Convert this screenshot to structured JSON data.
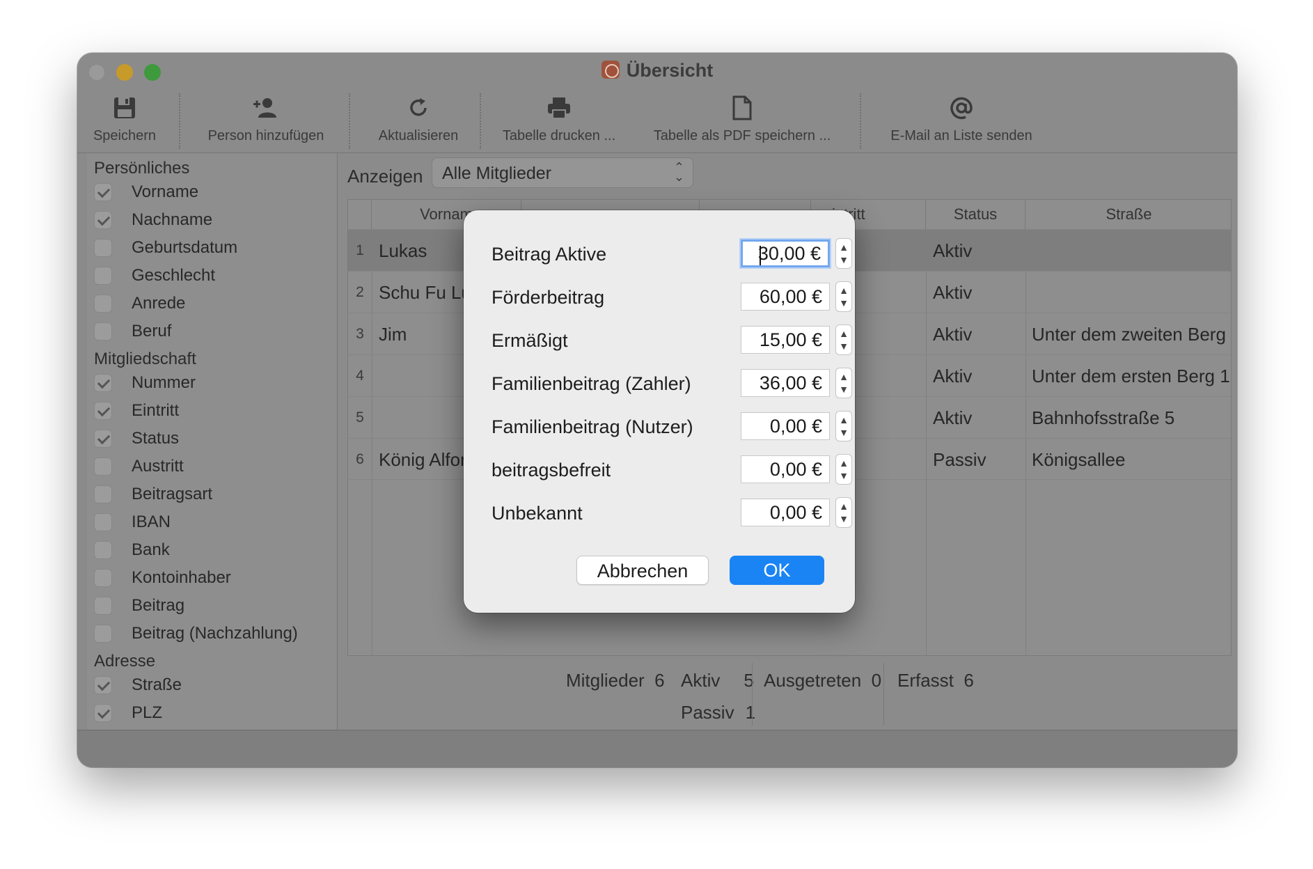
{
  "window": {
    "title": "Übersicht"
  },
  "toolbar": {
    "items": [
      {
        "label": "Speichern",
        "icon": "save-icon"
      },
      {
        "label": "Person hinzufügen",
        "icon": "add-person-icon"
      },
      {
        "label": "Aktualisieren",
        "icon": "refresh-icon"
      },
      {
        "label": "Tabelle drucken ...",
        "icon": "printer-icon"
      },
      {
        "label": "Tabelle als PDF speichern ...",
        "icon": "document-icon"
      },
      {
        "label": "E-Mail an Liste senden",
        "icon": "at-sign-icon"
      }
    ]
  },
  "sidebar": {
    "sections": [
      {
        "title": "Persönliches",
        "items": [
          {
            "label": "Vorname",
            "checked": true
          },
          {
            "label": "Nachname",
            "checked": true
          },
          {
            "label": "Geburtsdatum",
            "checked": false
          },
          {
            "label": "Geschlecht",
            "checked": false
          },
          {
            "label": "Anrede",
            "checked": false
          },
          {
            "label": "Beruf",
            "checked": false
          }
        ]
      },
      {
        "title": "Mitgliedschaft",
        "items": [
          {
            "label": "Nummer",
            "checked": true
          },
          {
            "label": "Eintritt",
            "checked": true
          },
          {
            "label": "Status",
            "checked": true
          },
          {
            "label": "Austritt",
            "checked": false
          },
          {
            "label": "Beitragsart",
            "checked": false
          },
          {
            "label": "IBAN",
            "checked": false
          },
          {
            "label": "Bank",
            "checked": false
          },
          {
            "label": "Kontoinhaber",
            "checked": false
          },
          {
            "label": "Beitrag",
            "checked": false
          },
          {
            "label": "Beitrag (Nachzahlung)",
            "checked": false
          }
        ]
      },
      {
        "title": "Adresse",
        "items": [
          {
            "label": "Straße",
            "checked": true
          },
          {
            "label": "PLZ",
            "checked": true
          }
        ]
      }
    ]
  },
  "main": {
    "show_label": "Anzeigen",
    "show_select": "Alle Mitglieder",
    "table": {
      "headers": {
        "vorname": "Vornam",
        "eintritt": "intritt",
        "status": "Status",
        "strasse": "Straße"
      },
      "rows": [
        {
          "num": "1",
          "vorname": "Lukas",
          "status": "Aktiv",
          "strasse": ""
        },
        {
          "num": "2",
          "vorname": "Schu Fu Lu",
          "status": "Aktiv",
          "strasse": ""
        },
        {
          "num": "3",
          "vorname": "Jim",
          "status": "Aktiv",
          "strasse": "Unter dem zweiten Berg"
        },
        {
          "num": "4",
          "vorname": "",
          "status": "Aktiv",
          "strasse": "Unter dem ersten Berg 1"
        },
        {
          "num": "5",
          "vorname": "",
          "status": "Aktiv",
          "strasse": "Bahnhofsstraße 5"
        },
        {
          "num": "6",
          "vorname": "König Alfor",
          "status": "Passiv",
          "strasse": "Königsallee"
        }
      ]
    },
    "stats": {
      "mitglieder_label": "Mitglieder",
      "mitglieder": "6",
      "aktiv_label": "Aktiv",
      "aktiv": "5",
      "passiv_label": "Passiv",
      "passiv": "1",
      "ausgetreten_label": "Ausgetreten",
      "ausgetreten": "0",
      "erfasst_label": "Erfasst",
      "erfasst": "6"
    }
  },
  "dialog": {
    "fields": [
      {
        "label": "Beitrag Aktive",
        "value": "30,00 €",
        "focused": true
      },
      {
        "label": "Förderbeitrag",
        "value": "60,00 €"
      },
      {
        "label": "Ermäßigt",
        "value": "15,00 €"
      },
      {
        "label": "Familienbeitrag (Zahler)",
        "value": "36,00 €"
      },
      {
        "label": "Familienbeitrag (Nutzer)",
        "value": "0,00 €"
      },
      {
        "label": "beitragsbefreit",
        "value": "0,00 €"
      },
      {
        "label": "Unbekannt",
        "value": "0,00 €"
      }
    ],
    "cancel_label": "Abbrechen",
    "ok_label": "OK"
  },
  "colors": {
    "accent": "#1a84f5",
    "focus_ring": "#74a7ee",
    "close": "#9a9a9a",
    "minimize": "#c79a2a",
    "maximize": "#3e9a3c"
  }
}
